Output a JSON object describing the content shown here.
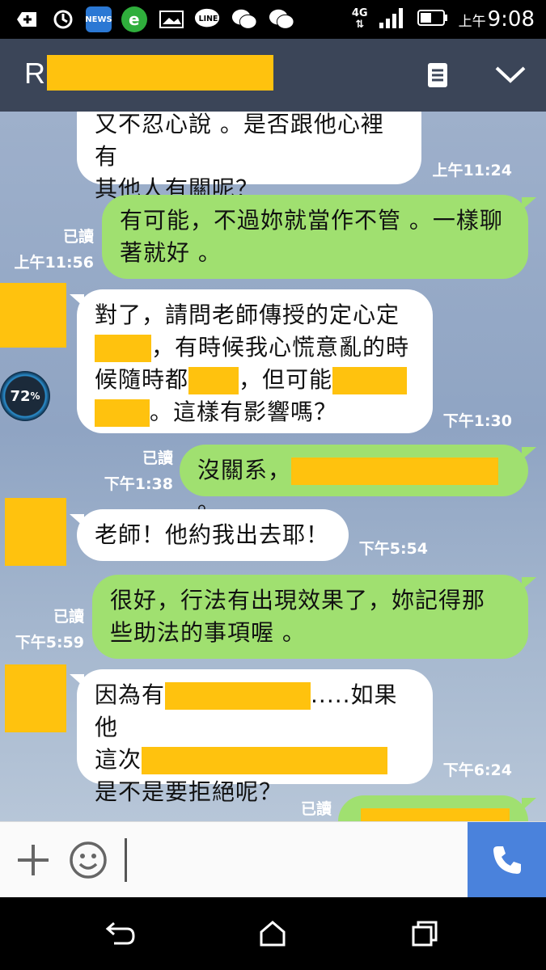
{
  "status_bar": {
    "time_prefix": "上午",
    "time": "9:08",
    "network": "4G",
    "icons": [
      "plus-icon",
      "sync-icon",
      "news-icon",
      "browser-icon",
      "image-icon",
      "line-icon",
      "wechat-icon",
      "wechat-icon-2"
    ]
  },
  "header": {
    "title_initial": "R",
    "menu_icon": "note-icon",
    "collapse_icon": "chevron-down-icon"
  },
  "messages": [
    {
      "side": "in",
      "lines": [
        "又不忍心說 。是否跟他心裡有",
        "其他人有關呢？"
      ],
      "time": "上午11:24"
    },
    {
      "side": "out",
      "lines": [
        "有可能，不過妳就當作不管 。一樣聊",
        "著就好 。"
      ],
      "read": "已讀",
      "time": "上午11:56"
    },
    {
      "side": "in",
      "line1": "對了，請問老師傳授的定心定",
      "line2_after": "，有時候我心慌意亂的時",
      "line3_before": "候隨時都",
      "line3_mid": "，但可能",
      "line4_after": "。這樣有影響嗎？",
      "time": "下午1:30"
    },
    {
      "side": "out",
      "text_before": "沒關系，",
      "text_after": "。",
      "read": "已讀",
      "time": "下午1:38"
    },
    {
      "side": "in",
      "lines": [
        "老師！他約我出去耶！"
      ],
      "time": "下午5:54"
    },
    {
      "side": "out",
      "lines": [
        "很好，行法有出現效果了，妳記得那",
        "些助法的事項喔 。"
      ],
      "read": "已讀",
      "time": "下午5:59"
    },
    {
      "side": "in",
      "line1_before": "因為有",
      "line1_after": ".....如果他",
      "line2_before": "這次",
      "line3": "是不是要拒絕呢？",
      "time": "下午6:24"
    },
    {
      "side": "out",
      "read": "已讀"
    }
  ],
  "floating_badge": {
    "value": "72",
    "unit": "%"
  },
  "input_bar": {
    "add_icon": "plus-icon",
    "emoji_icon": "smiley-icon",
    "call_icon": "phone-icon"
  },
  "nav_bar": {
    "icons": [
      "back-icon",
      "home-icon",
      "recents-icon"
    ]
  },
  "colors": {
    "header": "#3b4558",
    "outgoing": "#a0e070",
    "incoming": "#ffffff",
    "redaction": "#ffc20e",
    "call_button": "#4a82dc"
  }
}
